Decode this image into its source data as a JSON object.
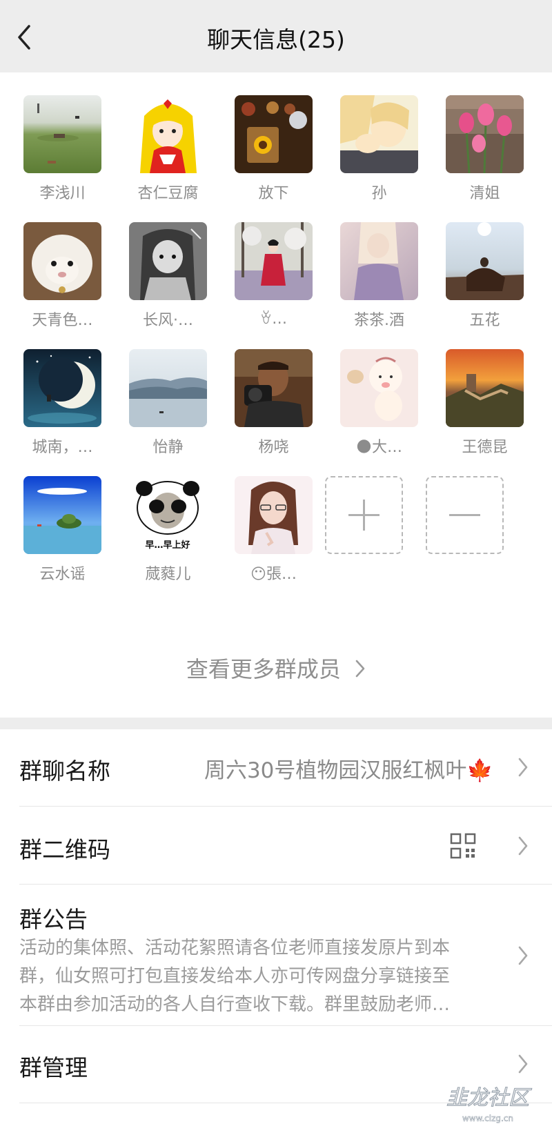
{
  "nav": {
    "title": "聊天信息(25)"
  },
  "members": [
    {
      "name": "李浅川",
      "avatar": "grassy-hill-photo"
    },
    {
      "name": "杏仁豆腐",
      "avatar": "cartoon-girl-yellow-hair"
    },
    {
      "name": "放下",
      "avatar": "sunflower-lightbox-photo"
    },
    {
      "name": "孙",
      "avatar": "anime-kiss-illustration"
    },
    {
      "name": "清姐",
      "avatar": "pink-tulips-photo"
    },
    {
      "name": "天青色…",
      "avatar": "white-lamb-photo"
    },
    {
      "name": "长风·…",
      "avatar": "manga-girl-sketch"
    },
    {
      "name": "ꈊ…",
      "avatar": "red-hanfu-blossom-photo"
    },
    {
      "name": "茶茶.酒",
      "avatar": "soft-girl-photo"
    },
    {
      "name": "五花",
      "avatar": "horse-rider-sunset-photo"
    },
    {
      "name": "城南，…",
      "avatar": "crescent-moon-illustration"
    },
    {
      "name": "怡静",
      "avatar": "misty-lake-mountains-photo"
    },
    {
      "name": "杨哓",
      "avatar": "photographer-man-photo"
    },
    {
      "name": "🌑大…",
      "avatar": "baby-cartoon-illustration"
    },
    {
      "name": "王德昆",
      "avatar": "great-wall-sunset-photo"
    },
    {
      "name": "云水谣",
      "avatar": "blue-sky-island-photo"
    },
    {
      "name": "蒇蕤儿",
      "avatar": "panda-meme-face",
      "caption": "早…早上好"
    },
    {
      "name": "😶張…",
      "avatar": "woman-selfie-photo"
    }
  ],
  "controls": {
    "add_icon": "plus-icon",
    "remove_icon": "minus-icon"
  },
  "more_members": {
    "label": "查看更多群成员"
  },
  "settings": {
    "group_name": {
      "label": "群聊名称",
      "value": "周六30号植物园汉服红枫叶🍁"
    },
    "qr_code": {
      "label": "群二维码",
      "icon": "qr-code-icon"
    },
    "notice": {
      "label": "群公告",
      "line1": "活动的集体照、活动花絮照请各位老师直接发原片到本",
      "line2": "群，仙女照可打包直接发给本人亦可传网盘分享链接至",
      "line3": "本群由参加活动的各人自行查收下载。群里鼓励老师…"
    },
    "manage": {
      "label": "群管理"
    }
  },
  "watermark": {
    "text": "韭龙社区",
    "url": "www.clzg.cn"
  },
  "colors": {
    "nav_bg": "#ededed",
    "secondary_text": "#8c8c8c",
    "divider": "#e6e6e6"
  }
}
